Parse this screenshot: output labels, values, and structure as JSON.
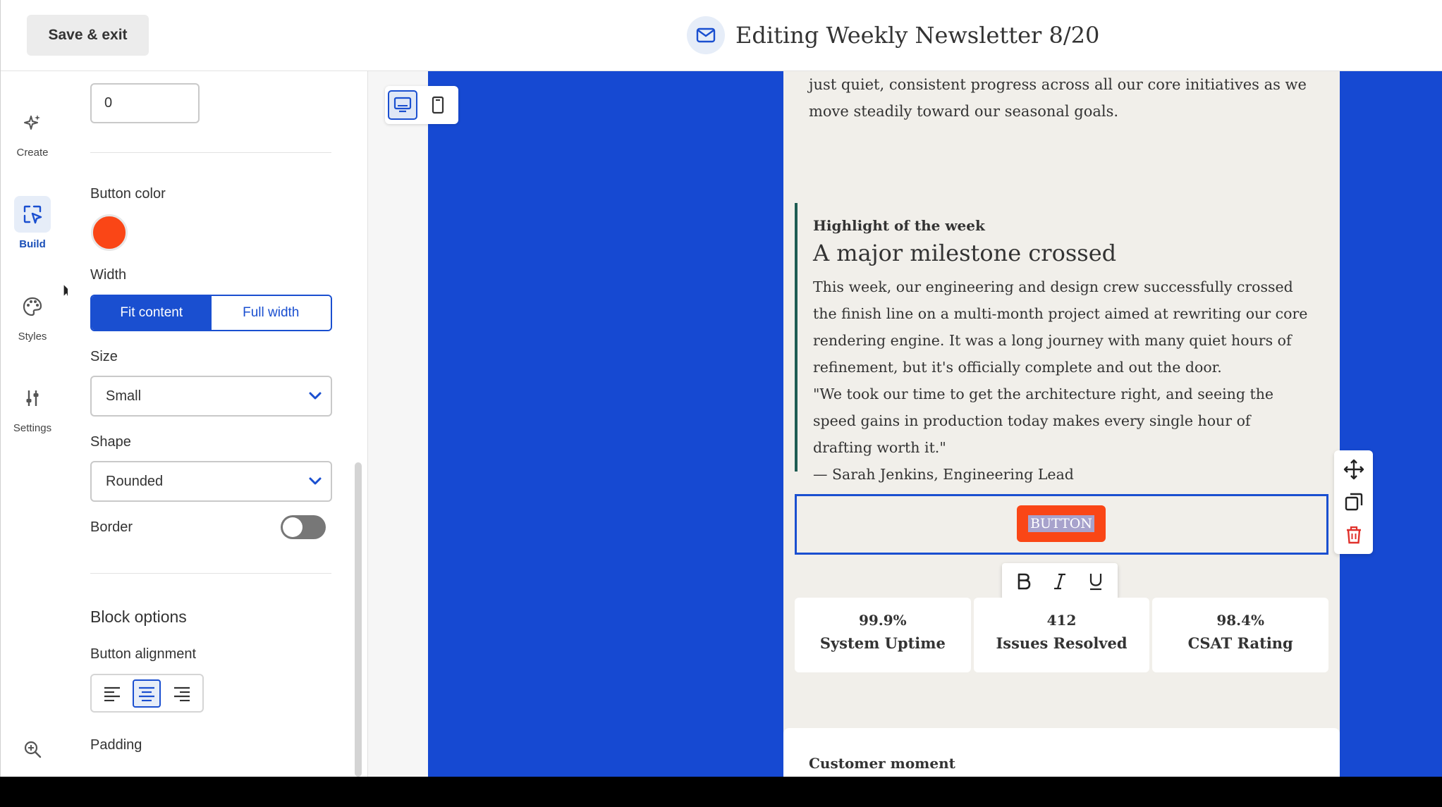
{
  "topbar": {
    "save_label": "Save & exit",
    "title": "Editing Weekly Newsletter 8/20",
    "mail_icon": "mail-icon"
  },
  "rail": {
    "items": [
      {
        "label": "Create",
        "icon": "sparkle-icon",
        "active": false
      },
      {
        "label": "Build",
        "icon": "select-pointer-icon",
        "active": true
      },
      {
        "label": "Styles",
        "icon": "palette-icon",
        "active": false
      },
      {
        "label": "Settings",
        "icon": "sliders-icon",
        "active": false
      }
    ],
    "zoom_icon": "zoom-in-icon"
  },
  "panel": {
    "number_value": "0",
    "button_color_label": "Button color",
    "button_color": "#fa4616",
    "width_label": "Width",
    "width_options": [
      "Fit content",
      "Full width"
    ],
    "width_selected": "Fit content",
    "size_label": "Size",
    "size_value": "Small",
    "shape_label": "Shape",
    "shape_value": "Rounded",
    "border_label": "Border",
    "border_on": false,
    "block_options_label": "Block options",
    "alignment_label": "Button alignment",
    "alignment_selected": "center",
    "padding_label": "Padding"
  },
  "canvas": {
    "device_modes": [
      "desktop",
      "mobile"
    ],
    "device_selected": "desktop",
    "background_color": "#1649d2",
    "email": {
      "intro_text": "just quiet, consistent progress across all our core initiatives as we move steadily toward our seasonal goals.",
      "highlight": {
        "kicker": "Highlight of the week",
        "heading": "A major milestone crossed",
        "body": "This week, our engineering and design crew successfully crossed the finish line on a multi-month project aimed at rewriting our core rendering engine. It was a long journey with many quiet hours of refinement, but it's officially complete and out the door.",
        "quote": "\"We took our time to get the architecture right, and seeing the speed gains in production today makes every single hour of drafting worth it.\"",
        "attribution": "— Sarah Jenkins, Engineering Lead"
      },
      "button_text": "BUTTON",
      "format_tools": [
        "bold-icon",
        "italic-icon",
        "underline-icon"
      ],
      "stats": [
        {
          "value": "99.9%",
          "label": "System Uptime"
        },
        {
          "value": "412",
          "label": "Issues Resolved"
        },
        {
          "value": "98.4%",
          "label": "CSAT Rating"
        }
      ],
      "customer_title": "Customer moment"
    },
    "block_tools": [
      "move-icon",
      "duplicate-icon",
      "delete-icon"
    ]
  }
}
